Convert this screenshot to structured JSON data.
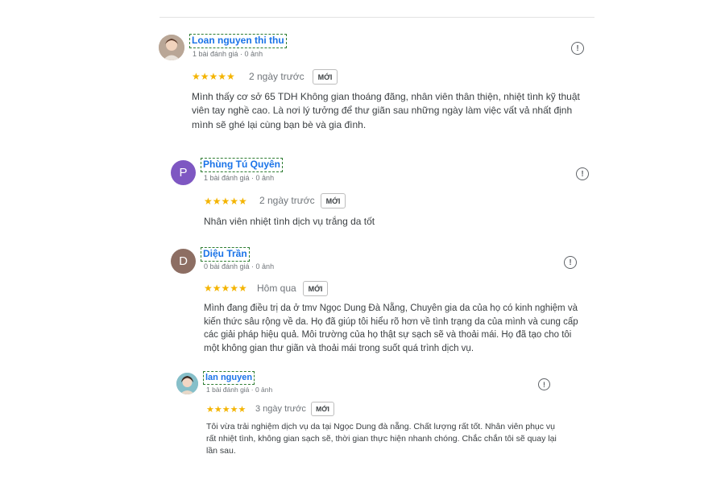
{
  "reviews": [
    {
      "name": "Loan nguyen thi thu",
      "meta": "1 bài đánh giá · 0 ảnh",
      "stars": "★★★★★",
      "date": "2 ngày trước",
      "badge": "MỚI",
      "text": "Mình thấy cơ sở 65 TDH Không gian thoáng đãng, nhân viên thân thiện, nhiệt tình kỹ thuật viên tay nghề cao. Là nơi lý tưởng để thư giãn sau những ngày làm việc vất vả nhất định mình sẽ ghé lại cùng bạn bè và gia đình.",
      "avatar_icon": "photo-avatar",
      "rating": 5
    },
    {
      "name": "Phùng Tú Quyên",
      "meta": "1 bài đánh giá · 0 ảnh",
      "avatar_letter": "P",
      "avatar_color": "#7e57c2",
      "stars": "★★★★★",
      "date": "2 ngày trước",
      "badge": "MỚI",
      "text": "Nhân viên nhiệt tình dịch vụ trắng da tốt",
      "rating": 5
    },
    {
      "name": "Diệu Trần",
      "meta": "0 bài đánh giá · 0 ảnh",
      "avatar_letter": "D",
      "avatar_color": "#8d6e63",
      "stars": "★★★★★",
      "date": "Hôm qua",
      "badge": "MỚI",
      "text": "Mình đang điều trị da ở tmv Ngọc Dung Đà Nẵng, Chuyên gia da của họ có kinh nghiệm và kiến thức sâu rộng về da. Họ đã giúp tôi hiểu rõ hơn về tình trạng da của mình và cung cấp các giải pháp hiệu quả. Môi trường của họ thật sự sạch sẽ và thoải mái. Họ đã tạo cho tôi một không gian thư giãn và thoải mái trong suốt quá trình dịch vụ.",
      "rating": 5
    },
    {
      "name": "lan nguyen",
      "meta": "1 bài đánh giá · 0 ảnh",
      "stars": "★★★★★",
      "date": "3 ngày trước",
      "badge": "MỚI",
      "text": "Tôi vừa trải nghiệm dịch vụ da tại Ngọc Dung đà nẵng. Chất lượng rất tốt. Nhân viên phục vụ rất nhiệt tình, không gian sạch sẽ, thời gian thực hiện nhanh chóng. Chắc chắn tôi sẽ quay lại lần sau.",
      "avatar_icon": "photo-avatar",
      "rating": 5
    }
  ],
  "flag_glyph": "!",
  "colors": {
    "link": "#1a73e8",
    "star": "#f4b400",
    "muted": "#70757a"
  }
}
